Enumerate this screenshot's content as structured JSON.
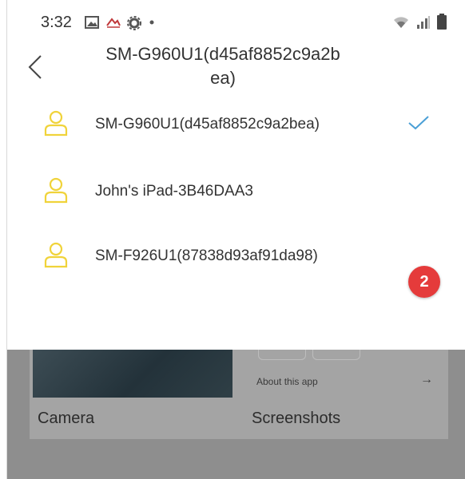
{
  "status_bar": {
    "time": "3:32"
  },
  "header": {
    "title_line1": "SM-G960U1(d45af8852c9a2b",
    "title_line2": "ea)"
  },
  "devices": [
    {
      "name": "SM-G960U1(d45af8852c9a2bea)",
      "selected": true
    },
    {
      "name": "John's iPad-3B46DAA3",
      "selected": false
    },
    {
      "name": "SM-F926U1(87838d93af91da98)",
      "selected": false
    }
  ],
  "badge": "2",
  "background": {
    "card1_caption": "Camera",
    "card2_about": "About this app",
    "card2_arrow": "→",
    "card2_caption": "Screenshots"
  },
  "colors": {
    "accent_check": "#4a9fd6",
    "person_icon": "#f0d33a",
    "badge_red": "#e53b3b"
  }
}
